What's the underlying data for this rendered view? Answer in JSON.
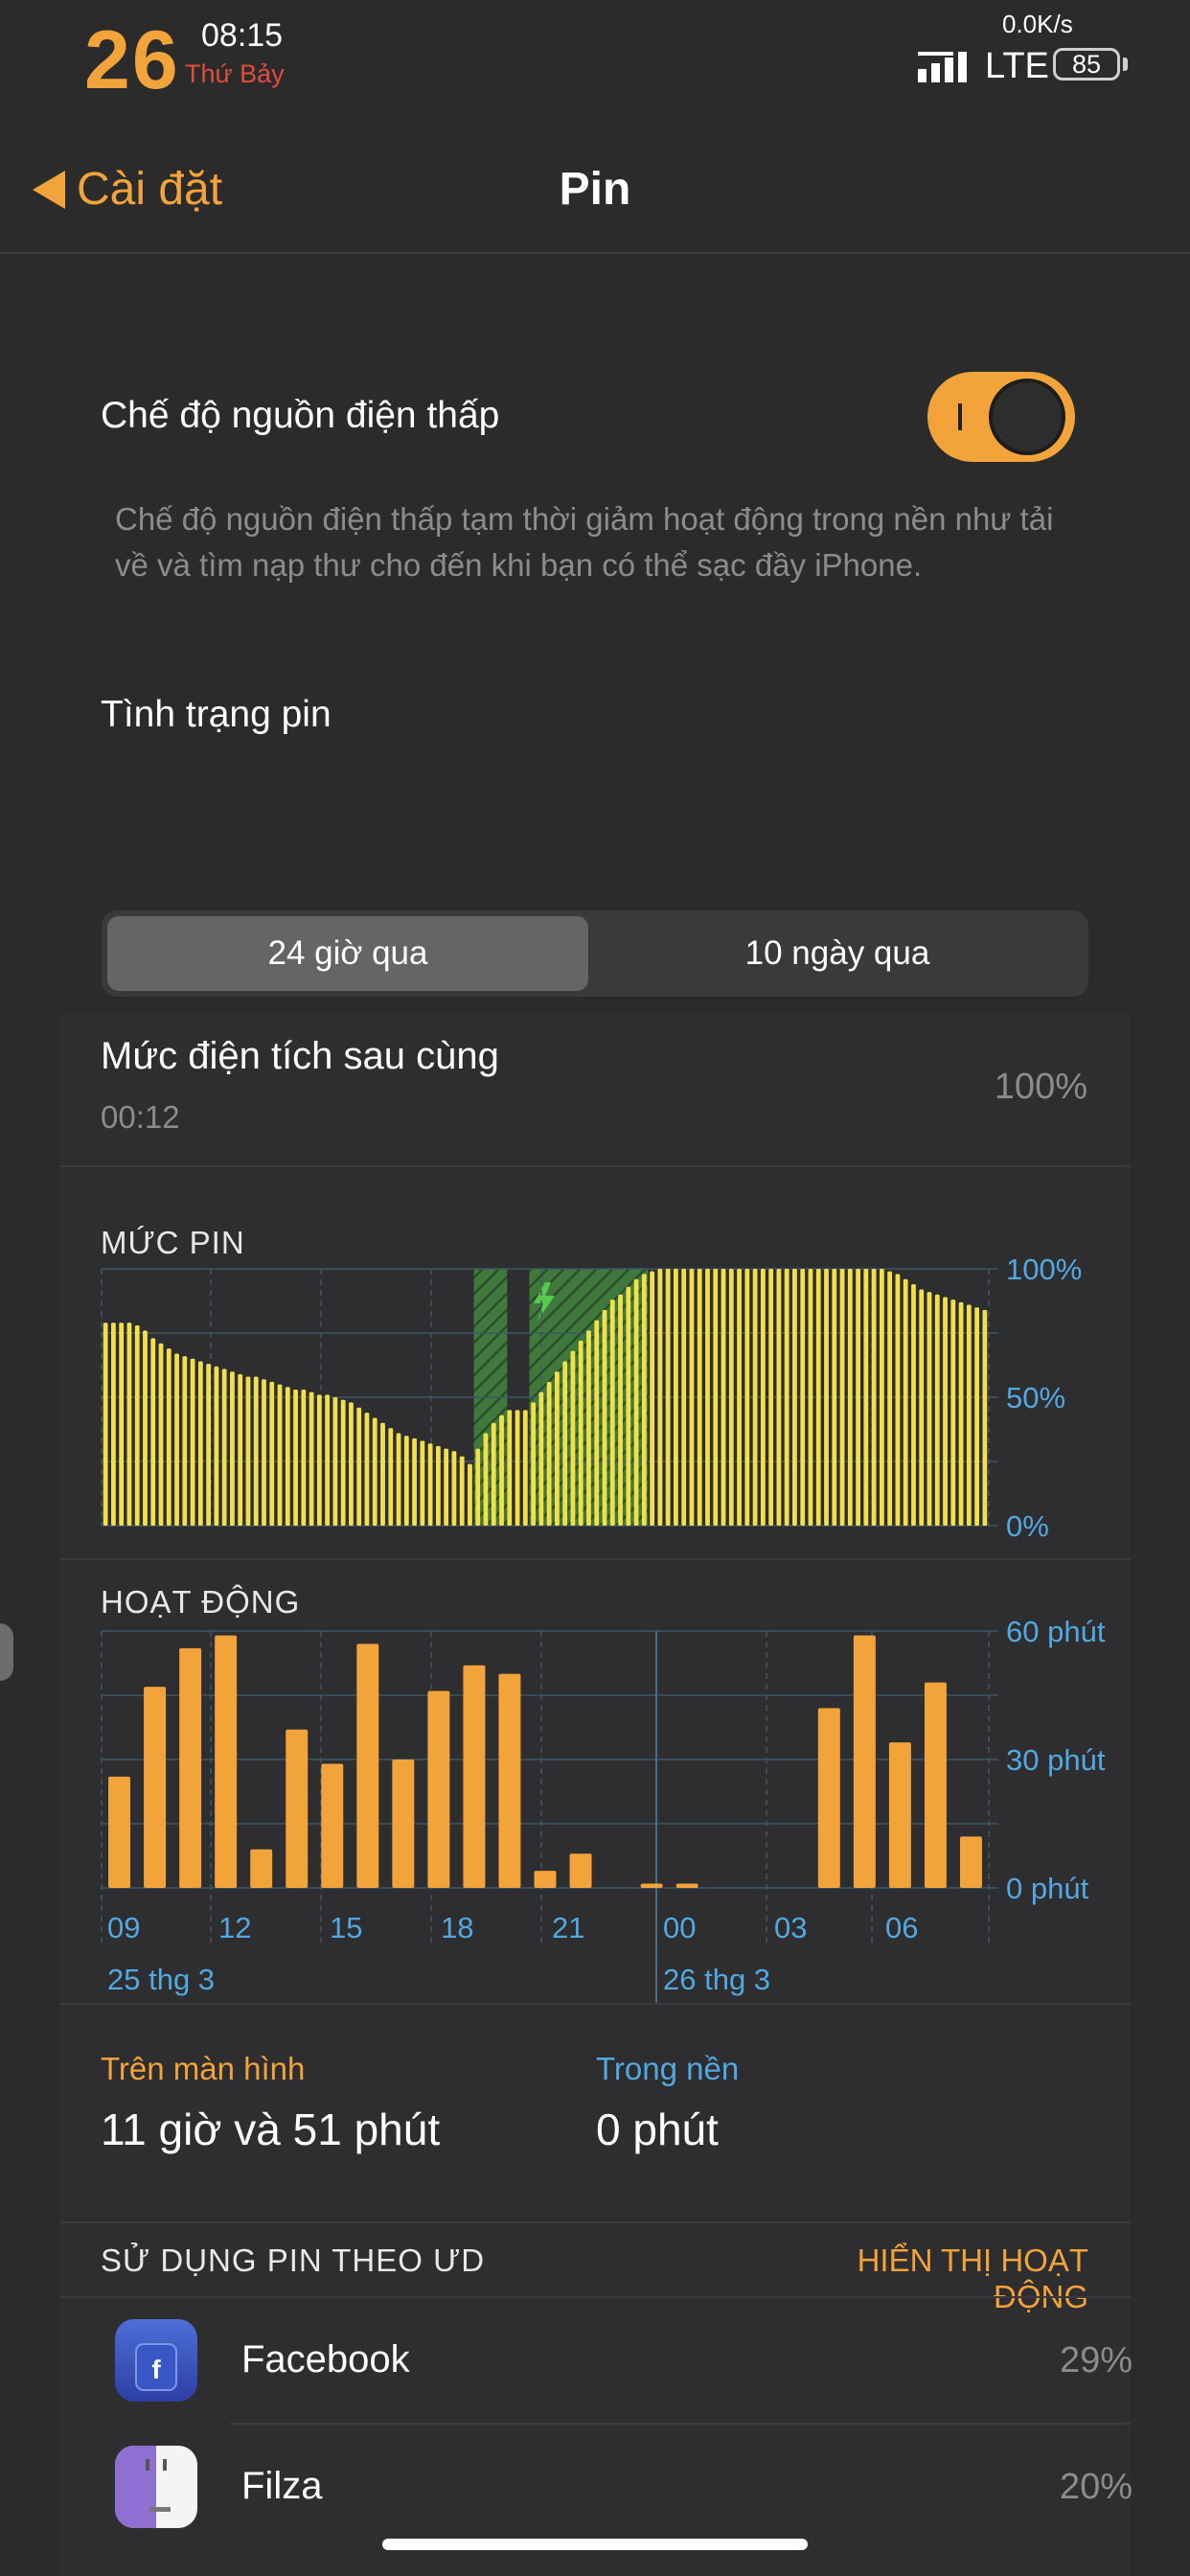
{
  "status_bar": {
    "day": "26",
    "time": "08:15",
    "weekday": "Thứ Bảy",
    "net_speed": "0.0K/s",
    "network": "LTE",
    "battery": "85"
  },
  "nav": {
    "back_label": "Cài đặt",
    "title": "Pin"
  },
  "low_power": {
    "label": "Chế độ nguồn điện thấp",
    "enabled": true,
    "description": "Chế độ nguồn điện thấp tạm thời giảm hoạt động trong nền như tải về và tìm nạp thư cho đến khi bạn có thể sạc đầy iPhone."
  },
  "battery_health": {
    "label": "Tình trạng pin"
  },
  "segments": {
    "active": "24 giờ qua",
    "inactive": "10 ngày qua"
  },
  "last_charge": {
    "label": "Mức điện tích sau cùng",
    "time": "00:12",
    "value": "100%"
  },
  "colors": {
    "accent": "#f2a33a",
    "level_bar": "#f3df4a",
    "charging_hatch": "#3f7a3c",
    "axis_blue": "#52a8e0"
  },
  "chart_data": [
    {
      "type": "bar",
      "title": "MỨC PIN",
      "y_ticks": [
        "100%",
        "50%",
        "0%"
      ],
      "ylim": [
        0,
        100
      ],
      "charging_icon": "lightning-bolt-icon",
      "values": [
        79,
        79,
        79,
        79,
        78,
        76,
        73,
        71,
        69,
        67,
        66,
        65,
        64,
        63,
        62,
        61,
        60,
        59,
        58,
        58,
        57,
        56,
        55,
        54,
        53,
        53,
        52,
        51,
        51,
        50,
        49,
        48,
        46,
        44,
        42,
        40,
        38,
        36,
        35,
        34,
        33,
        32,
        31,
        30,
        29,
        27,
        24,
        30,
        36,
        40,
        43,
        45,
        45,
        45,
        48,
        52,
        56,
        60,
        64,
        68,
        72,
        76,
        80,
        84,
        88,
        90,
        93,
        96,
        98,
        99,
        100,
        100,
        100,
        100,
        100,
        100,
        100,
        100,
        100,
        100,
        100,
        100,
        100,
        100,
        100,
        100,
        100,
        100,
        100,
        100,
        100,
        100,
        100,
        100,
        100,
        100,
        100,
        100,
        100,
        99,
        98,
        96,
        94,
        92,
        91,
        90,
        89,
        88,
        87,
        86,
        85,
        84
      ]
    },
    {
      "type": "bar",
      "title": "HOẠT ĐỘNG",
      "y_ticks": [
        "60 phút",
        "30 phút",
        "0 phút"
      ],
      "ylim": [
        0,
        60
      ],
      "x_ticks": [
        "09",
        "12",
        "15",
        "18",
        "21",
        "00",
        "03",
        "06"
      ],
      "date_labels": [
        "25 thg 3",
        "26 thg 3"
      ],
      "values": [
        26,
        47,
        56,
        59,
        9,
        37,
        29,
        57,
        30,
        46,
        52,
        50,
        4,
        8,
        0,
        1,
        1,
        0,
        0,
        0,
        42,
        59,
        34,
        48,
        12
      ]
    }
  ],
  "screen_time": {
    "on_screen_label": "Trên màn hình",
    "on_screen_value": "11 giờ và 51 phút",
    "background_label": "Trong nền",
    "background_value": "0 phút"
  },
  "usage": {
    "title": "SỬ DỤNG PIN THEO ƯD",
    "link": "HIỂN THỊ HOẠT ĐỘNG",
    "apps": [
      {
        "name": "Facebook",
        "percent": "29%",
        "icon": "facebook-icon"
      },
      {
        "name": "Filza",
        "percent": "20%",
        "icon": "filza-icon"
      }
    ]
  }
}
